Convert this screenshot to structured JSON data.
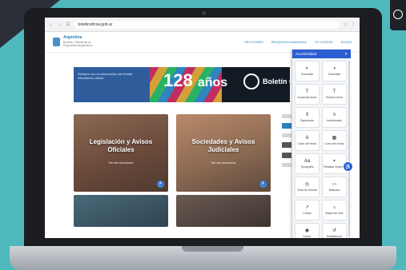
{
  "browser": {
    "url": "boletinoficial.gob.ar",
    "nav_back": "←",
    "nav_forward": "→",
    "nav_reload": "C"
  },
  "site": {
    "logo_title": "Argentina",
    "logo_subtitle": "Boletín Oficial de la República Argentina",
    "menu": [
      "SECCIONES",
      "BÚSQUEDA AVANZADA",
      "TU CUENTA",
      "AYUDA"
    ]
  },
  "banner": {
    "left_text": "Siempre con el compromiso de brindar información oficial",
    "years_number": "128",
    "years_word": "años",
    "brand": "Boletín Oficial"
  },
  "cards": [
    {
      "title": "Legislación y Avisos Oficiales",
      "subtitle": "Ver las secciones"
    },
    {
      "title": "Sociedades y Avisos Judiciales",
      "subtitle": "Ver las secciones"
    }
  ],
  "a11y_panel": {
    "title": "Accesibilidad",
    "close": "✕",
    "tiles": [
      {
        "icon": "◐",
        "label": "Contraste"
      },
      {
        "icon": "◑",
        "label": "Contraste"
      },
      {
        "icon": "T",
        "label": "Aumentar texto"
      },
      {
        "icon": "T",
        "label": "Reducir texto"
      },
      {
        "icon": "⇕",
        "label": "Espaciado"
      },
      {
        "icon": "≡",
        "label": "Interlineado"
      },
      {
        "icon": "A",
        "label": "Color del texto"
      },
      {
        "icon": "▦",
        "label": "Color del fondo"
      },
      {
        "icon": "Aa",
        "label": "Tipografía"
      },
      {
        "icon": "⌖",
        "label": "Resaltar enlaces"
      },
      {
        "icon": "◎",
        "label": "Guía de lectura"
      },
      {
        "icon": "▭",
        "label": "Máscara"
      },
      {
        "icon": "↗",
        "label": "Cursor"
      },
      {
        "icon": "⌂",
        "label": "Mapa del sitio"
      },
      {
        "icon": "◉",
        "label": "Lector"
      },
      {
        "icon": "↺",
        "label": "Restablecer"
      }
    ]
  }
}
